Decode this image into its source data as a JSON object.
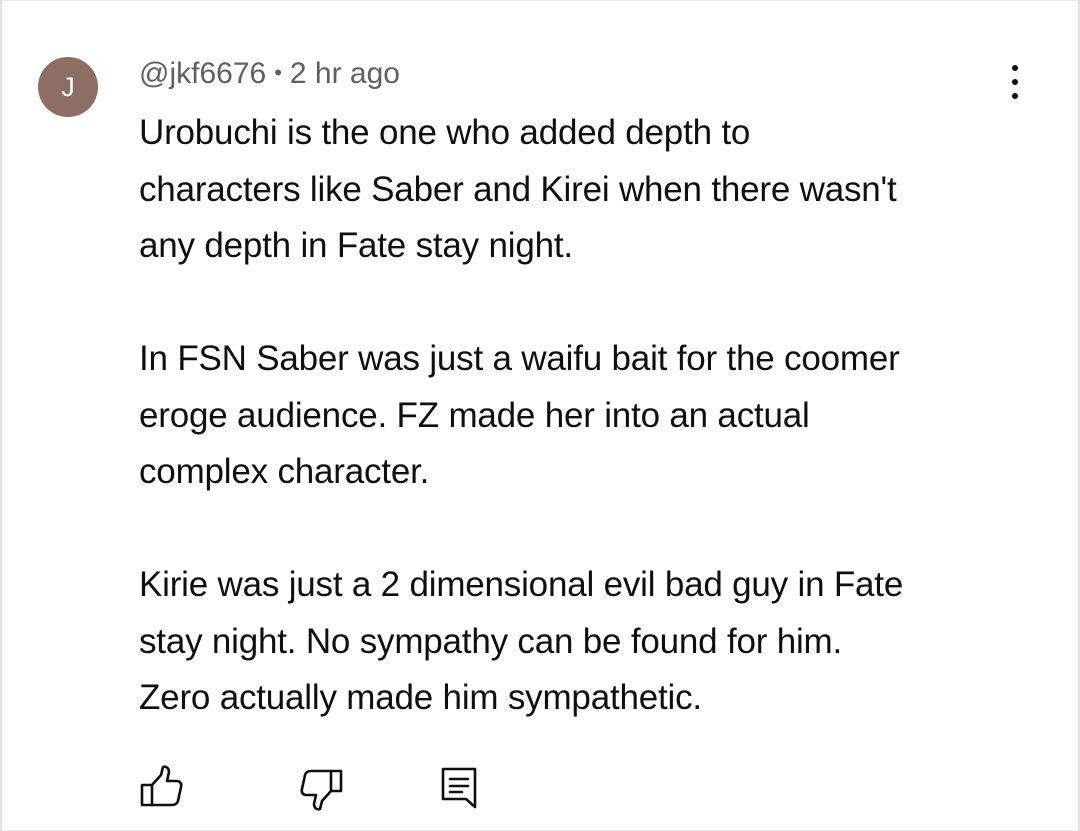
{
  "comment": {
    "avatar_initial": "J",
    "author": "@jkf6676",
    "separator": "•",
    "time": "2 hr ago",
    "paragraphs": [
      [
        "Urobuchi is the one who added depth to",
        "characters like Saber and Kirei when there wasn't",
        "any depth in Fate stay night."
      ],
      [
        "In FSN Saber was just a waifu bait for the coomer",
        "eroge audience. FZ made her into an actual",
        "complex character."
      ],
      [
        "Kirie was just a 2 dimensional evil bad guy in Fate",
        "stay night. No sympathy can be found for him.",
        "Zero actually made him sympathetic."
      ]
    ]
  },
  "icons": {
    "more": "more-vert-icon",
    "like": "thumbs-up-icon",
    "dislike": "thumbs-down-icon",
    "reply": "comment-reply-icon"
  },
  "colors": {
    "avatar_bg": "#8d6e63",
    "text": "#0f0f0f",
    "meta": "#606060",
    "icon": "#0f0f0f"
  }
}
